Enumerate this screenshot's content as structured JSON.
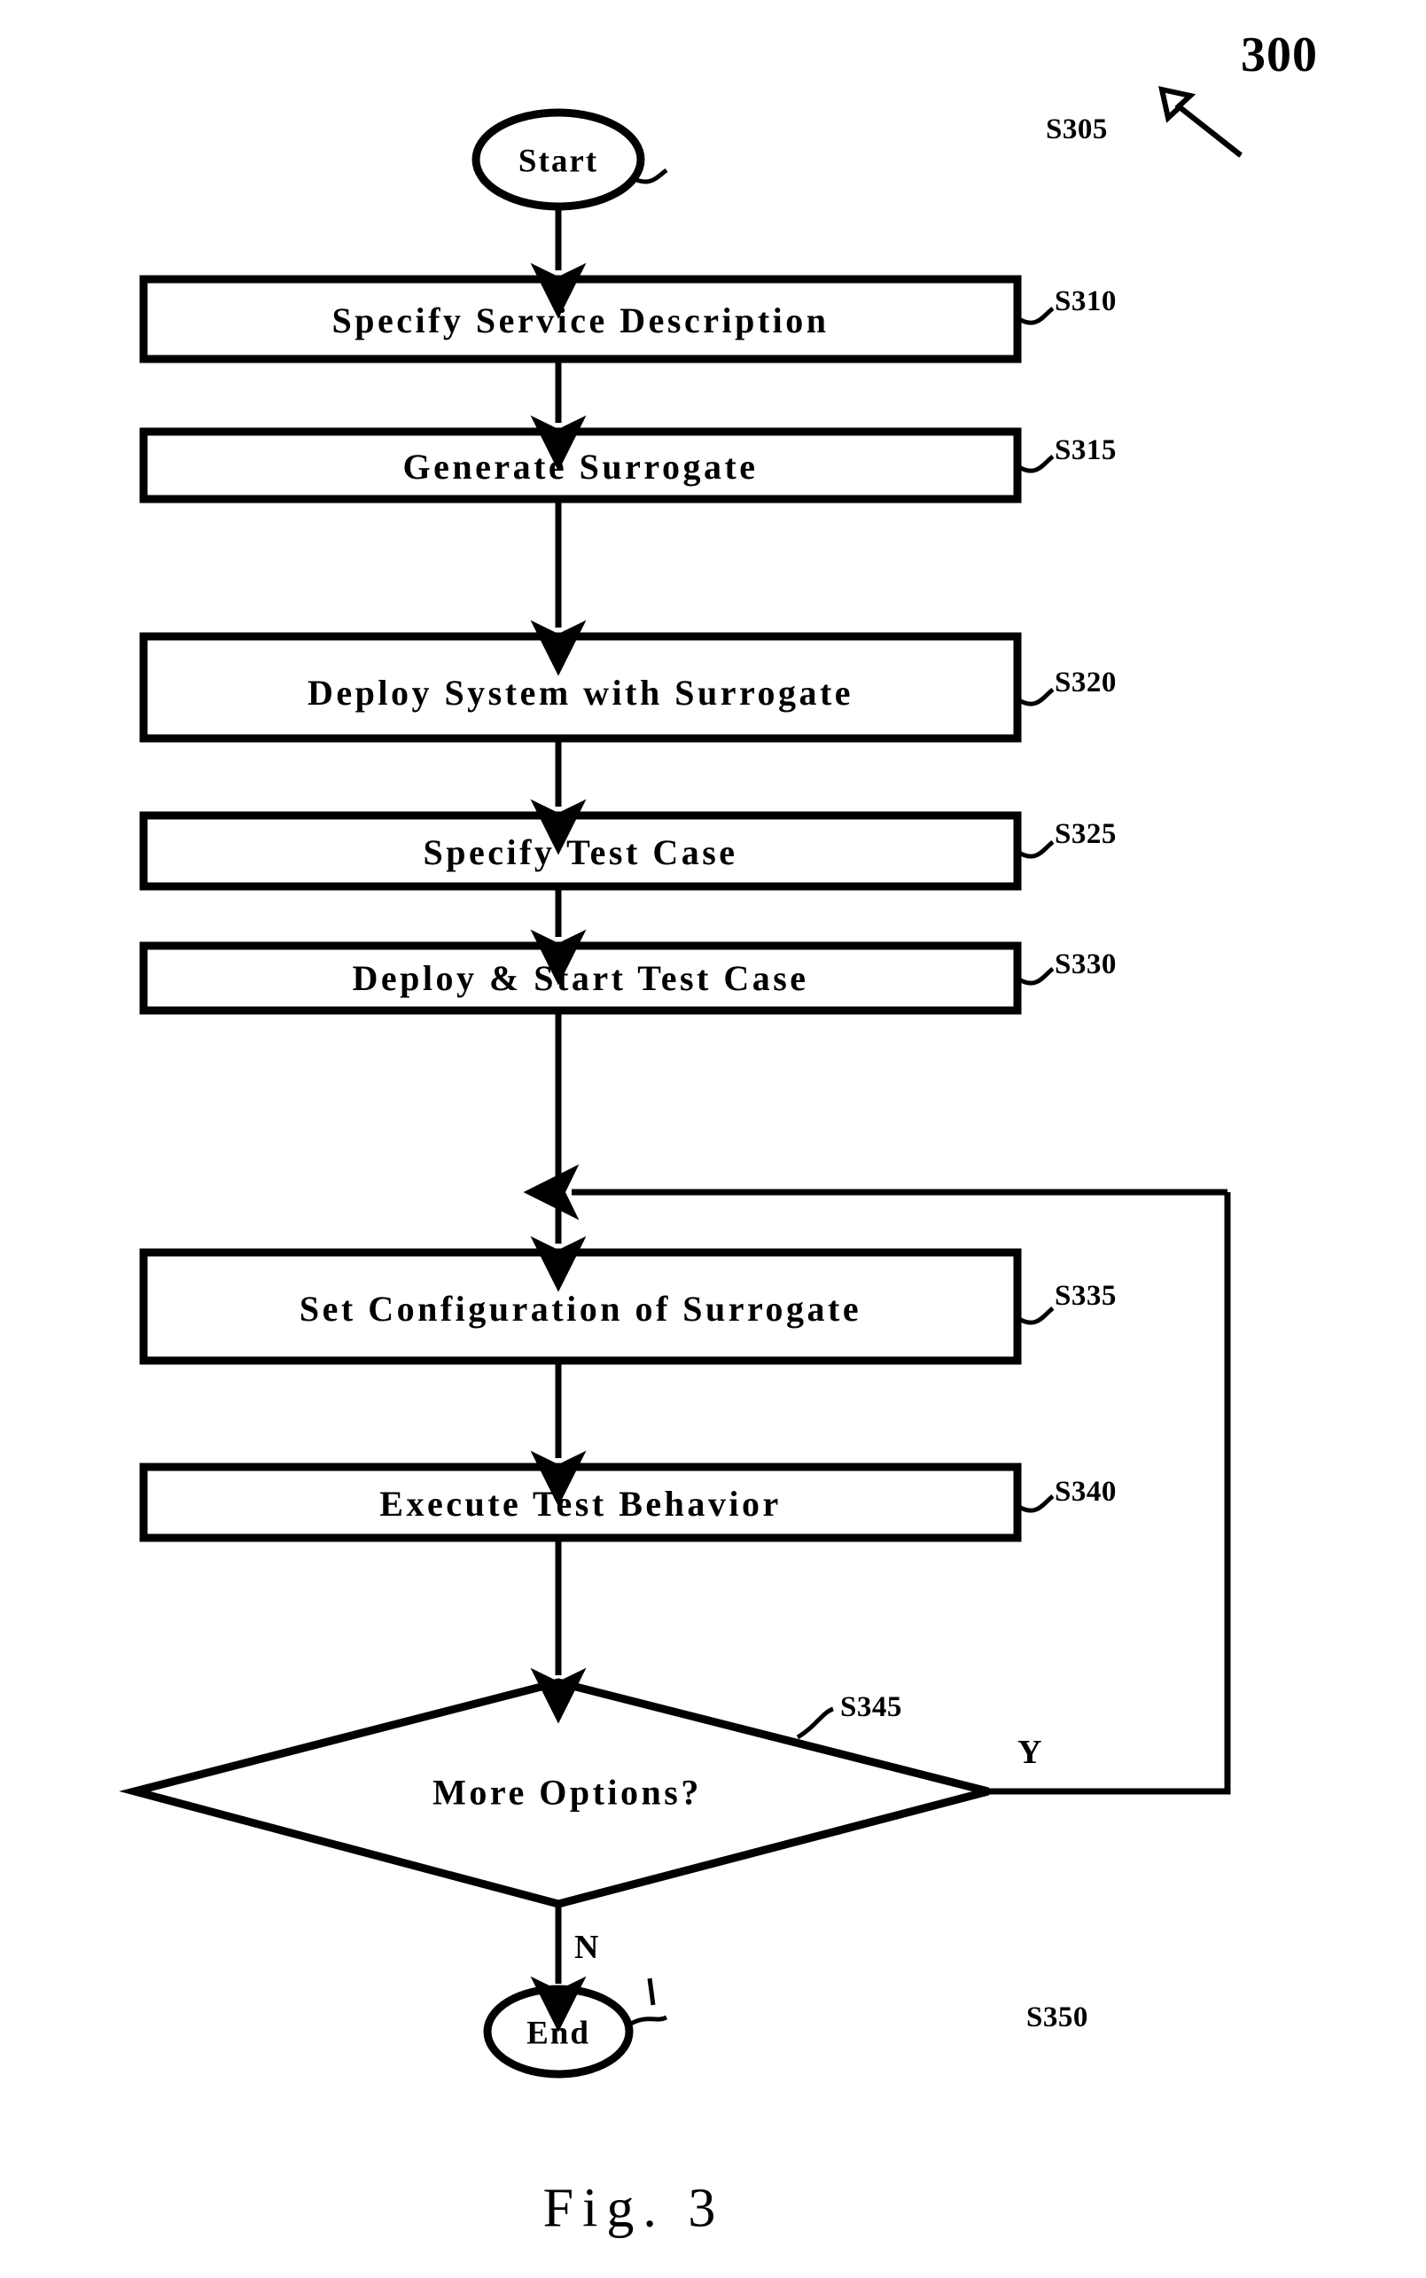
{
  "figure": {
    "caption": "Fig. 3",
    "reference_numeral": "300"
  },
  "terminators": [
    {
      "id": "start",
      "label": "Start",
      "step": "S305"
    },
    {
      "id": "end",
      "label": "End",
      "step": "S350"
    }
  ],
  "process_steps": [
    {
      "step": "S310",
      "label": "Specify Service Description"
    },
    {
      "step": "S315",
      "label": "Generate Surrogate"
    },
    {
      "step": "S320",
      "label": "Deploy System with Surrogate"
    },
    {
      "step": "S325",
      "label": "Specify Test Case"
    },
    {
      "step": "S330",
      "label": "Deploy & Start Test Case"
    },
    {
      "step": "S335",
      "label": "Set Configuration of Surrogate"
    },
    {
      "step": "S340",
      "label": "Execute Test Behavior"
    }
  ],
  "decision": {
    "step": "S345",
    "label": "More Options?",
    "yes_label": "Y",
    "no_label": "N"
  },
  "colors": {
    "stroke": "#000000",
    "background": "#ffffff"
  }
}
